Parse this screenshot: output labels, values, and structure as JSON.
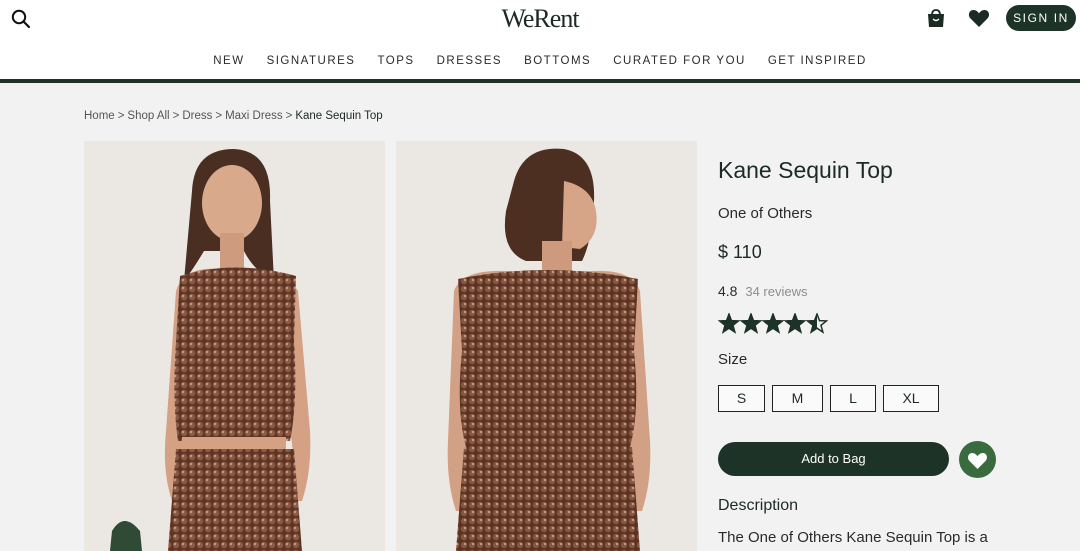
{
  "header": {
    "logo": "WeRent",
    "sign_in_label": "SIGN IN",
    "icons": {
      "search": "search-icon",
      "cart": "shopping-bag-icon",
      "wishlist": "heart-icon"
    }
  },
  "nav": {
    "items": [
      "NEW",
      "SIGNATURES",
      "TOPS",
      "DRESSES",
      "BOTTOMS",
      "CURATED FOR YOU",
      "GET INSPIRED"
    ]
  },
  "breadcrumb": {
    "items": [
      "Home",
      "Shop All",
      "Dress",
      "Maxi Dress"
    ],
    "current": "Kane Sequin Top",
    "separator": ">"
  },
  "product": {
    "title": "Kane Sequin Top",
    "brand": "One of Others",
    "price": "$ 110",
    "rating": "4.8",
    "rating_value": 4.5,
    "rating_max": 5,
    "reviews": "34 reviews",
    "size_label": "Size",
    "sizes": [
      "S",
      "M",
      "L",
      "XL"
    ],
    "add_to_bag": "Add to Bag",
    "description_title": "Description",
    "description_text": "The One of Others Kane Sequin Top is a"
  },
  "colors": {
    "brand_dark": "#1d3328",
    "wish_green": "#3a6b3f",
    "sequin_brown": "#6b3f2a"
  }
}
